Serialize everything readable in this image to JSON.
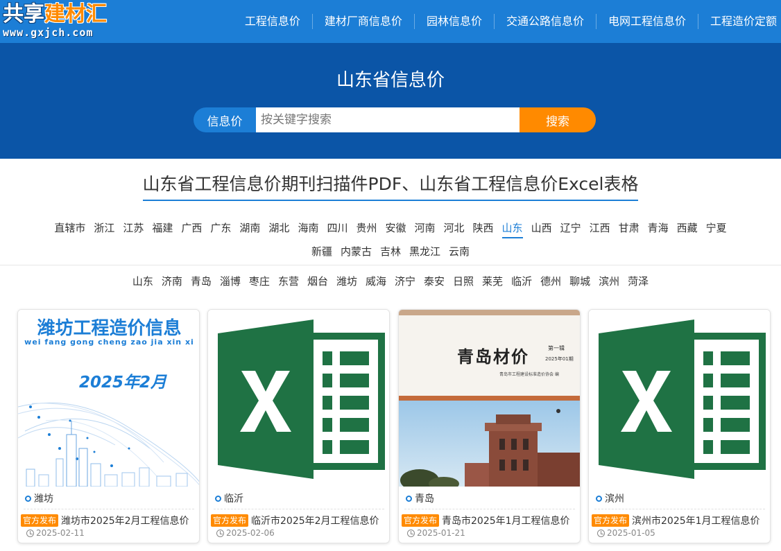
{
  "header": {
    "logo_text_1": "共享",
    "logo_text_2": "建材汇",
    "logo_url": "www.gxjch.com",
    "nav": [
      "工程信息价",
      "建材厂商信息价",
      "园林信息价",
      "交通公路信息价",
      "电网工程信息价",
      "工程造价定额"
    ]
  },
  "hero": {
    "title": "山东省信息价",
    "search_tag": "信息价",
    "search_placeholder": "按关键字搜索",
    "search_button": "搜索"
  },
  "main_title": "山东省工程信息价期刊扫描件PDF、山东省工程信息价Excel表格",
  "provinces": {
    "row1": [
      "直辖市",
      "浙江",
      "江苏",
      "福建",
      "广西",
      "广东",
      "湖南",
      "湖北",
      "海南",
      "四川",
      "贵州",
      "安徽",
      "河南",
      "河北",
      "陕西",
      "山东",
      "山西",
      "辽宁",
      "江西",
      "甘肃",
      "青海",
      "西藏",
      "宁夏"
    ],
    "row2": [
      "新疆",
      "内蒙古",
      "吉林",
      "黑龙江",
      "云南"
    ],
    "active": "山东"
  },
  "cities": [
    "山东",
    "济南",
    "青岛",
    "淄博",
    "枣庄",
    "东营",
    "烟台",
    "潍坊",
    "威海",
    "济宁",
    "泰安",
    "日照",
    "莱芜",
    "临沂",
    "德州",
    "聊城",
    "滨州",
    "菏泽"
  ],
  "cards": [
    {
      "city": "潍坊",
      "badge": "官方发布",
      "title": "潍坊市2025年2月工程信息价",
      "date": "2025-02-11",
      "cover_title": "潍坊工程造价信息",
      "cover_pinyin": "wei fang gong cheng zao jia xin xi",
      "cover_date": "2025年2月"
    },
    {
      "city": "临沂",
      "badge": "官方发布",
      "title": "临沂市2025年2月工程信息价",
      "date": "2025-02-06"
    },
    {
      "city": "青岛",
      "badge": "官方发布",
      "title": "青岛市2025年1月工程信息价",
      "date": "2025-01-21",
      "cover_title": "青岛材价",
      "cover_issue": "第一辑",
      "cover_period": "2025年01期",
      "cover_assoc": "青岛市工程建设标准造价协会 编"
    },
    {
      "city": "滨州",
      "badge": "官方发布",
      "title": "滨州市2025年1月工程信息价",
      "date": "2025-01-05"
    }
  ],
  "colors": {
    "topbar": "#1c7ed6",
    "hero": "#0b55a7",
    "accent": "#ff8a00",
    "excel_green": "#1f7244"
  }
}
